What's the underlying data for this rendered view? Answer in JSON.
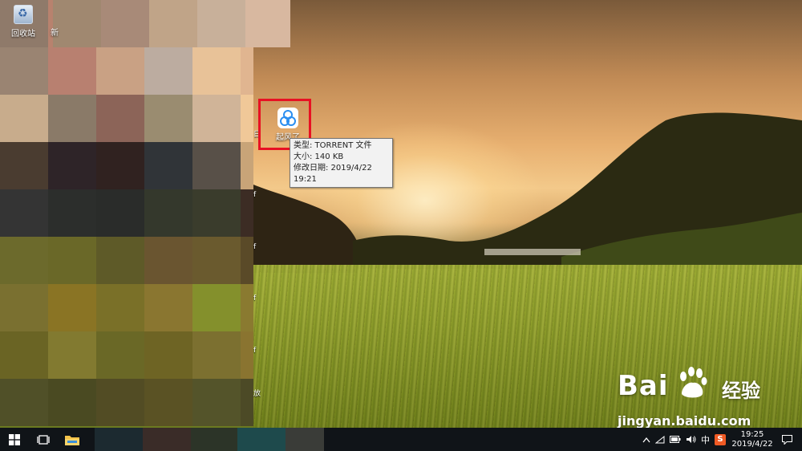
{
  "desktop": {
    "icons": {
      "recycle_bin": "回收站",
      "partial_new": "新",
      "torrent_file": "起风了"
    },
    "tooltip": {
      "type": "类型: TORRENT 文件",
      "size": "大小: 140 KB",
      "modified": "修改日期: 2019/4/22 19:21"
    },
    "edge_chars": [
      "日",
      "f",
      "f",
      "f",
      "f",
      "放"
    ],
    "highlight_color": "#e81123"
  },
  "watermark": {
    "brand": "Bai",
    "brand_cn": "经验",
    "url": "jingyan.baidu.com"
  },
  "taskbar": {
    "tray": {
      "ime": "中",
      "sogou": "S"
    },
    "clock": {
      "time": "19:25",
      "date": "2019/4/22"
    }
  }
}
